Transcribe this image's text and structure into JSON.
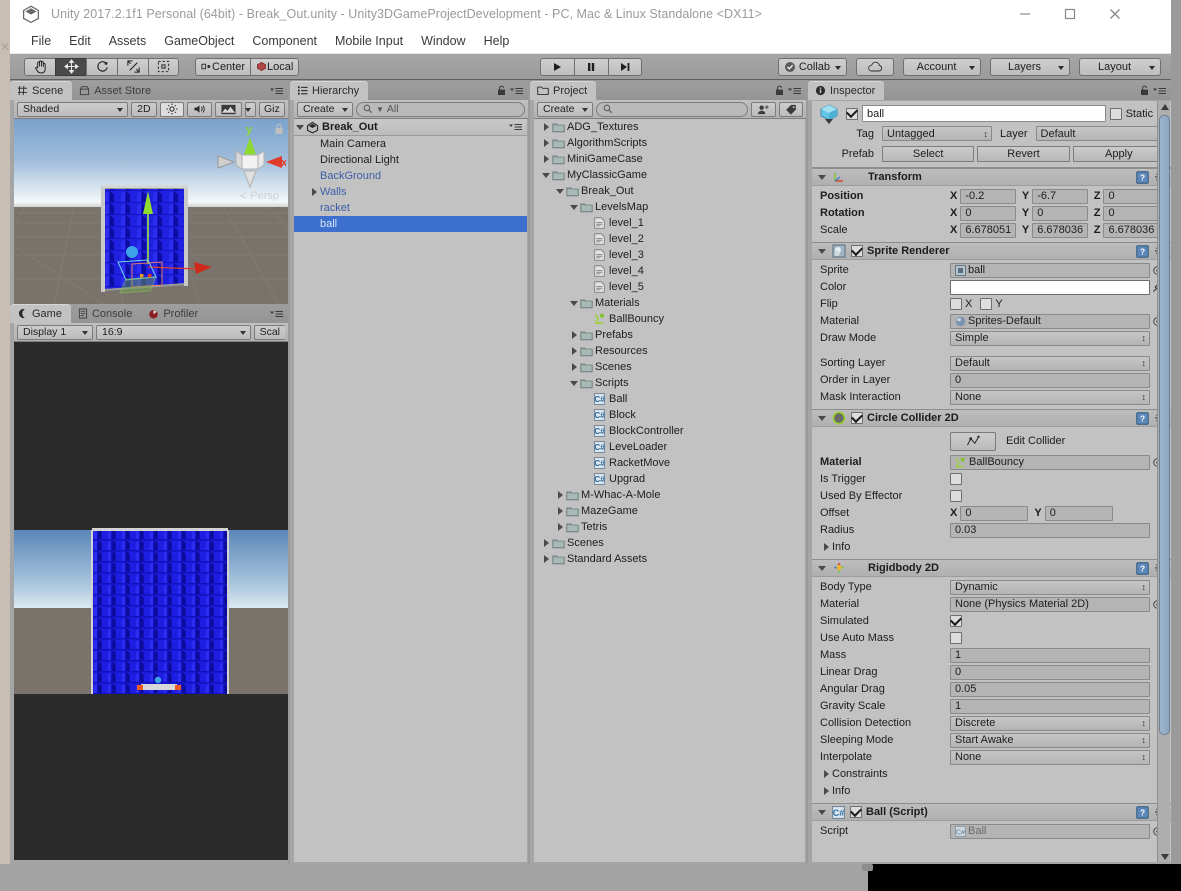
{
  "window": {
    "title": "Unity 2017.2.1f1 Personal (64bit) - Break_Out.unity - Unity3DGameProjectDevelopment - PC, Mac & Linux Standalone <DX11>",
    "minimize_label": "minimize-icon",
    "maximize_label": "maximize-icon",
    "close_label": "close-icon"
  },
  "menubar": {
    "items": [
      {
        "label": "File"
      },
      {
        "label": "Edit"
      },
      {
        "label": "Assets"
      },
      {
        "label": "GameObject"
      },
      {
        "label": "Component"
      },
      {
        "label": "Mobile Input"
      },
      {
        "label": "Window"
      },
      {
        "label": "Help"
      }
    ]
  },
  "toolbar": {
    "tools": [
      {
        "name": "hand-tool",
        "icon": "hand-icon",
        "active": false
      },
      {
        "name": "move-tool",
        "icon": "move-icon",
        "active": true
      },
      {
        "name": "rotate-tool",
        "icon": "rotate-icon",
        "active": false
      },
      {
        "name": "scale-tool",
        "icon": "scale-icon",
        "active": false
      },
      {
        "name": "rect-tool",
        "icon": "rect-transform-icon",
        "active": false
      }
    ],
    "pivot_mode": "Center",
    "pivot_rotation": "Local",
    "play": "play-icon",
    "pause": "pause-icon",
    "step": "step-icon",
    "collab": "Collab",
    "cloud": "cloud-icon",
    "account": "Account",
    "layers": "Layers",
    "layout": "Layout"
  },
  "scene_view": {
    "tabs": [
      {
        "label": "Scene",
        "icon": "scene-grid-icon",
        "active": true
      },
      {
        "label": "Asset Store",
        "icon": "asset-store-icon",
        "active": false
      }
    ],
    "shading_mode": "Shaded",
    "mode_2d": "2D",
    "lighting": "sun-icon",
    "audio": "audio-icon",
    "effects": "effects-icon",
    "gizmos": "Giz",
    "gizmo_axis_x": "x",
    "gizmo_axis_y": "y",
    "projection_label": "Persp"
  },
  "game_view": {
    "tabs": [
      {
        "label": "Game",
        "icon": "game-pad-icon",
        "active": true
      },
      {
        "label": "Console",
        "icon": "console-icon",
        "active": false
      },
      {
        "label": "Profiler",
        "icon": "profiler-icon",
        "active": false
      }
    ],
    "display": "Display 1",
    "aspect": "16:9",
    "scale_label": "Scal"
  },
  "hierarchy": {
    "tab_label": "Hierarchy",
    "tab_icon": "hierarchy-list-icon",
    "create_label": "Create",
    "search_placeholder": "All",
    "scene_name": "Break_Out",
    "items": [
      {
        "label": "Main Camera",
        "depth": 1,
        "expandable": false,
        "prefab": false,
        "selected": false
      },
      {
        "label": "Directional Light",
        "depth": 1,
        "expandable": false,
        "prefab": false,
        "selected": false
      },
      {
        "label": "BackGround",
        "depth": 1,
        "expandable": false,
        "prefab": true,
        "selected": false
      },
      {
        "label": "Walls",
        "depth": 1,
        "expandable": true,
        "prefab": true,
        "selected": false
      },
      {
        "label": "racket",
        "depth": 1,
        "expandable": false,
        "prefab": true,
        "selected": false
      },
      {
        "label": "ball",
        "depth": 1,
        "expandable": false,
        "prefab": true,
        "selected": true
      }
    ]
  },
  "project": {
    "tab_label": "Project",
    "tab_icon": "folder-icon",
    "create_label": "Create",
    "search_placeholder": "",
    "items": [
      {
        "label": "ADG_Textures",
        "depth": 0,
        "type": "folder",
        "state": "collapsed"
      },
      {
        "label": "AlgorithmScripts",
        "depth": 0,
        "type": "folder",
        "state": "collapsed"
      },
      {
        "label": "MiniGameCase",
        "depth": 0,
        "type": "folder",
        "state": "collapsed"
      },
      {
        "label": "MyClassicGame",
        "depth": 0,
        "type": "folder",
        "state": "expanded"
      },
      {
        "label": "Break_Out",
        "depth": 1,
        "type": "folder",
        "state": "expanded"
      },
      {
        "label": "LevelsMap",
        "depth": 2,
        "type": "folder",
        "state": "expanded"
      },
      {
        "label": "level_1",
        "depth": 3,
        "type": "textasset",
        "state": "none"
      },
      {
        "label": "level_2",
        "depth": 3,
        "type": "textasset",
        "state": "none"
      },
      {
        "label": "level_3",
        "depth": 3,
        "type": "textasset",
        "state": "none"
      },
      {
        "label": "level_4",
        "depth": 3,
        "type": "textasset",
        "state": "none"
      },
      {
        "label": "level_5",
        "depth": 3,
        "type": "textasset",
        "state": "none"
      },
      {
        "label": "Materials",
        "depth": 2,
        "type": "folder",
        "state": "expanded"
      },
      {
        "label": "BallBouncy",
        "depth": 3,
        "type": "physicsmaterial",
        "state": "none"
      },
      {
        "label": "Prefabs",
        "depth": 2,
        "type": "folder",
        "state": "collapsed"
      },
      {
        "label": "Resources",
        "depth": 2,
        "type": "folder",
        "state": "collapsed"
      },
      {
        "label": "Scenes",
        "depth": 2,
        "type": "folder",
        "state": "collapsed"
      },
      {
        "label": "Scripts",
        "depth": 2,
        "type": "folder",
        "state": "expanded"
      },
      {
        "label": "Ball",
        "depth": 3,
        "type": "script",
        "state": "none"
      },
      {
        "label": "Block",
        "depth": 3,
        "type": "script",
        "state": "none"
      },
      {
        "label": "BlockController",
        "depth": 3,
        "type": "script",
        "state": "none"
      },
      {
        "label": "LeveLoader",
        "depth": 3,
        "type": "script",
        "state": "none"
      },
      {
        "label": "RacketMove",
        "depth": 3,
        "type": "script",
        "state": "none"
      },
      {
        "label": "Upgrad",
        "depth": 3,
        "type": "script",
        "state": "none"
      },
      {
        "label": "M-Whac-A-Mole",
        "depth": 1,
        "type": "folder",
        "state": "collapsed"
      },
      {
        "label": "MazeGame",
        "depth": 1,
        "type": "folder",
        "state": "collapsed"
      },
      {
        "label": "Tetris",
        "depth": 1,
        "type": "folder",
        "state": "collapsed"
      },
      {
        "label": "Scenes",
        "depth": 0,
        "type": "folder",
        "state": "collapsed"
      },
      {
        "label": "Standard Assets",
        "depth": 0,
        "type": "folder",
        "state": "collapsed"
      }
    ]
  },
  "inspector": {
    "tab_label": "Inspector",
    "tab_icon": "info-icon",
    "object_name": "ball",
    "object_enabled": true,
    "static_label": "Static",
    "static_checked": false,
    "tag_label": "Tag",
    "tag_value": "Untagged",
    "layer_label": "Layer",
    "layer_value": "Default",
    "prefab_label": "Prefab",
    "prefab_buttons": [
      "Select",
      "Revert",
      "Apply"
    ],
    "components": [
      {
        "name": "Transform",
        "icon": "transform-icon",
        "has_checkbox": false,
        "rows": [
          {
            "label": "Position",
            "bold": true,
            "type": "vec3",
            "x": "-0.2",
            "y": "-6.7",
            "z": "0"
          },
          {
            "label": "Rotation",
            "bold": true,
            "type": "vec3",
            "x": "0",
            "y": "0",
            "z": "0"
          },
          {
            "label": "Scale",
            "bold": false,
            "type": "vec3",
            "x": "6.678051",
            "y": "6.678036",
            "z": "6.678036"
          }
        ]
      },
      {
        "name": "Sprite Renderer",
        "icon": "sprite-renderer-icon",
        "has_checkbox": true,
        "checked": true,
        "rows": [
          {
            "label": "Sprite",
            "type": "object",
            "value": "ball",
            "icon": "sprite-icon"
          },
          {
            "label": "Color",
            "type": "color",
            "value": "#ffffff"
          },
          {
            "label": "Flip",
            "type": "flip",
            "x_label": "X",
            "y_label": "Y",
            "x": false,
            "y": false
          },
          {
            "label": "Material",
            "type": "object",
            "value": "Sprites-Default",
            "icon": "material-icon"
          },
          {
            "label": "Draw Mode",
            "type": "dropdown",
            "value": "Simple"
          },
          {
            "label": "",
            "type": "spacer"
          },
          {
            "label": "Sorting Layer",
            "type": "dropdown",
            "value": "Default"
          },
          {
            "label": "Order in Layer",
            "type": "text",
            "value": "0"
          },
          {
            "label": "Mask Interaction",
            "type": "dropdown",
            "value": "None"
          }
        ]
      },
      {
        "name": "Circle Collider 2D",
        "icon": "circle-collider-icon",
        "has_checkbox": true,
        "checked": true,
        "rows": [
          {
            "label": "",
            "type": "editcollider",
            "value": "Edit Collider"
          },
          {
            "label": "Material",
            "bold": true,
            "type": "object",
            "value": "BallBouncy",
            "icon": "physics-material-icon"
          },
          {
            "label": "Is Trigger",
            "type": "checkbox",
            "checked": false
          },
          {
            "label": "Used By Effector",
            "type": "checkbox",
            "checked": false
          },
          {
            "label": "Offset",
            "type": "vec2",
            "x": "0",
            "y": "0"
          },
          {
            "label": "Radius",
            "type": "text",
            "value": "0.03"
          },
          {
            "label": "Info",
            "type": "foldout"
          }
        ]
      },
      {
        "name": "Rigidbody 2D",
        "icon": "rigidbody-icon",
        "has_checkbox": false,
        "rows": [
          {
            "label": "Body Type",
            "type": "dropdown",
            "value": "Dynamic"
          },
          {
            "label": "Material",
            "type": "object",
            "value": "None (Physics Material 2D)"
          },
          {
            "label": "Simulated",
            "type": "checkbox",
            "checked": true
          },
          {
            "label": "Use Auto Mass",
            "type": "checkbox",
            "checked": false
          },
          {
            "label": "Mass",
            "type": "text",
            "value": "1"
          },
          {
            "label": "Linear Drag",
            "type": "text",
            "value": "0"
          },
          {
            "label": "Angular Drag",
            "type": "text",
            "value": "0.05"
          },
          {
            "label": "Gravity Scale",
            "type": "text",
            "value": "1"
          },
          {
            "label": "Collision Detection",
            "type": "dropdown",
            "value": "Discrete"
          },
          {
            "label": "Sleeping Mode",
            "type": "dropdown",
            "value": "Start Awake"
          },
          {
            "label": "Interpolate",
            "type": "dropdown",
            "value": "None"
          },
          {
            "label": "Constraints",
            "type": "foldout"
          },
          {
            "label": "Info",
            "type": "foldout"
          }
        ]
      },
      {
        "name": "Ball (Script)",
        "icon": "script-icon",
        "has_checkbox": true,
        "checked": true,
        "rows": [
          {
            "label": "Script",
            "type": "object",
            "value": "Ball",
            "icon": "script-icon",
            "dim": true
          }
        ]
      }
    ]
  },
  "colors": {
    "selection_blue": "#3c6fce",
    "prefab_blue": "#3f5fa8",
    "panel_gray": "#c2c2c2",
    "chrome_gray": "#a5a5a5",
    "toolbar_gray": "#9b9b9b",
    "game_bg": "#2b2b2b",
    "brick_blue": "#1a1ad8"
  }
}
